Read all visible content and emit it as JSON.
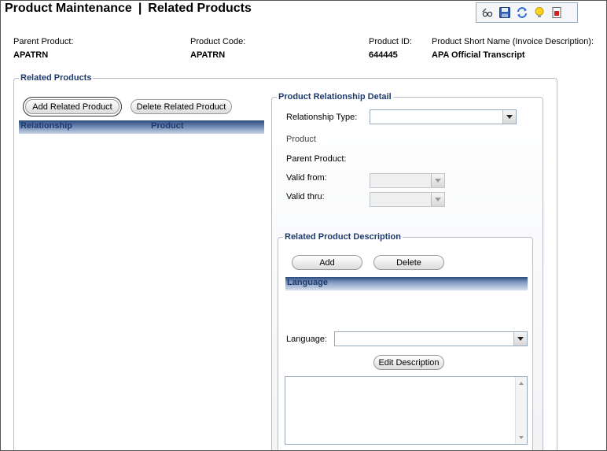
{
  "header": {
    "title_left": "Product Maintenance",
    "title_sep": "|",
    "title_right": "Related Products"
  },
  "toolbar": {
    "icons": [
      "eyeglasses-icon",
      "save-icon",
      "refresh-icon",
      "lightbulb-icon",
      "report-icon"
    ]
  },
  "product_info": {
    "parent_product_label": "Parent Product:",
    "parent_product_value": "APATRN",
    "product_code_label": "Product Code:",
    "product_code_value": "APATRN",
    "product_id_label": "Product ID:",
    "product_id_value": "644445",
    "short_name_label": "Product Short Name (Invoice Description):",
    "short_name_value": "APA Official Transcript"
  },
  "related_products": {
    "legend": "Related Products",
    "add_button": "Add Related Product",
    "delete_button": "Delete Related Product",
    "columns": [
      "Relationship",
      "Product"
    ]
  },
  "relationship_detail": {
    "legend": "Product Relationship Detail",
    "relationship_type_label": "Relationship Type:",
    "relationship_type_value": "",
    "product_label": "Product",
    "parent_product_label": "Parent Product:",
    "valid_from_label": "Valid from:",
    "valid_thru_label": "Valid thru:"
  },
  "description": {
    "legend": "Related Product Description",
    "add_button": "Add",
    "delete_button": "Delete",
    "column": "Language",
    "language_label": "Language:",
    "language_value": "",
    "edit_button": "Edit Description",
    "description_text": ""
  },
  "colors": {
    "legend_text": "#1f3a6c",
    "grid_header_dark": "#2a4a7c",
    "border": "#b7bec8"
  }
}
